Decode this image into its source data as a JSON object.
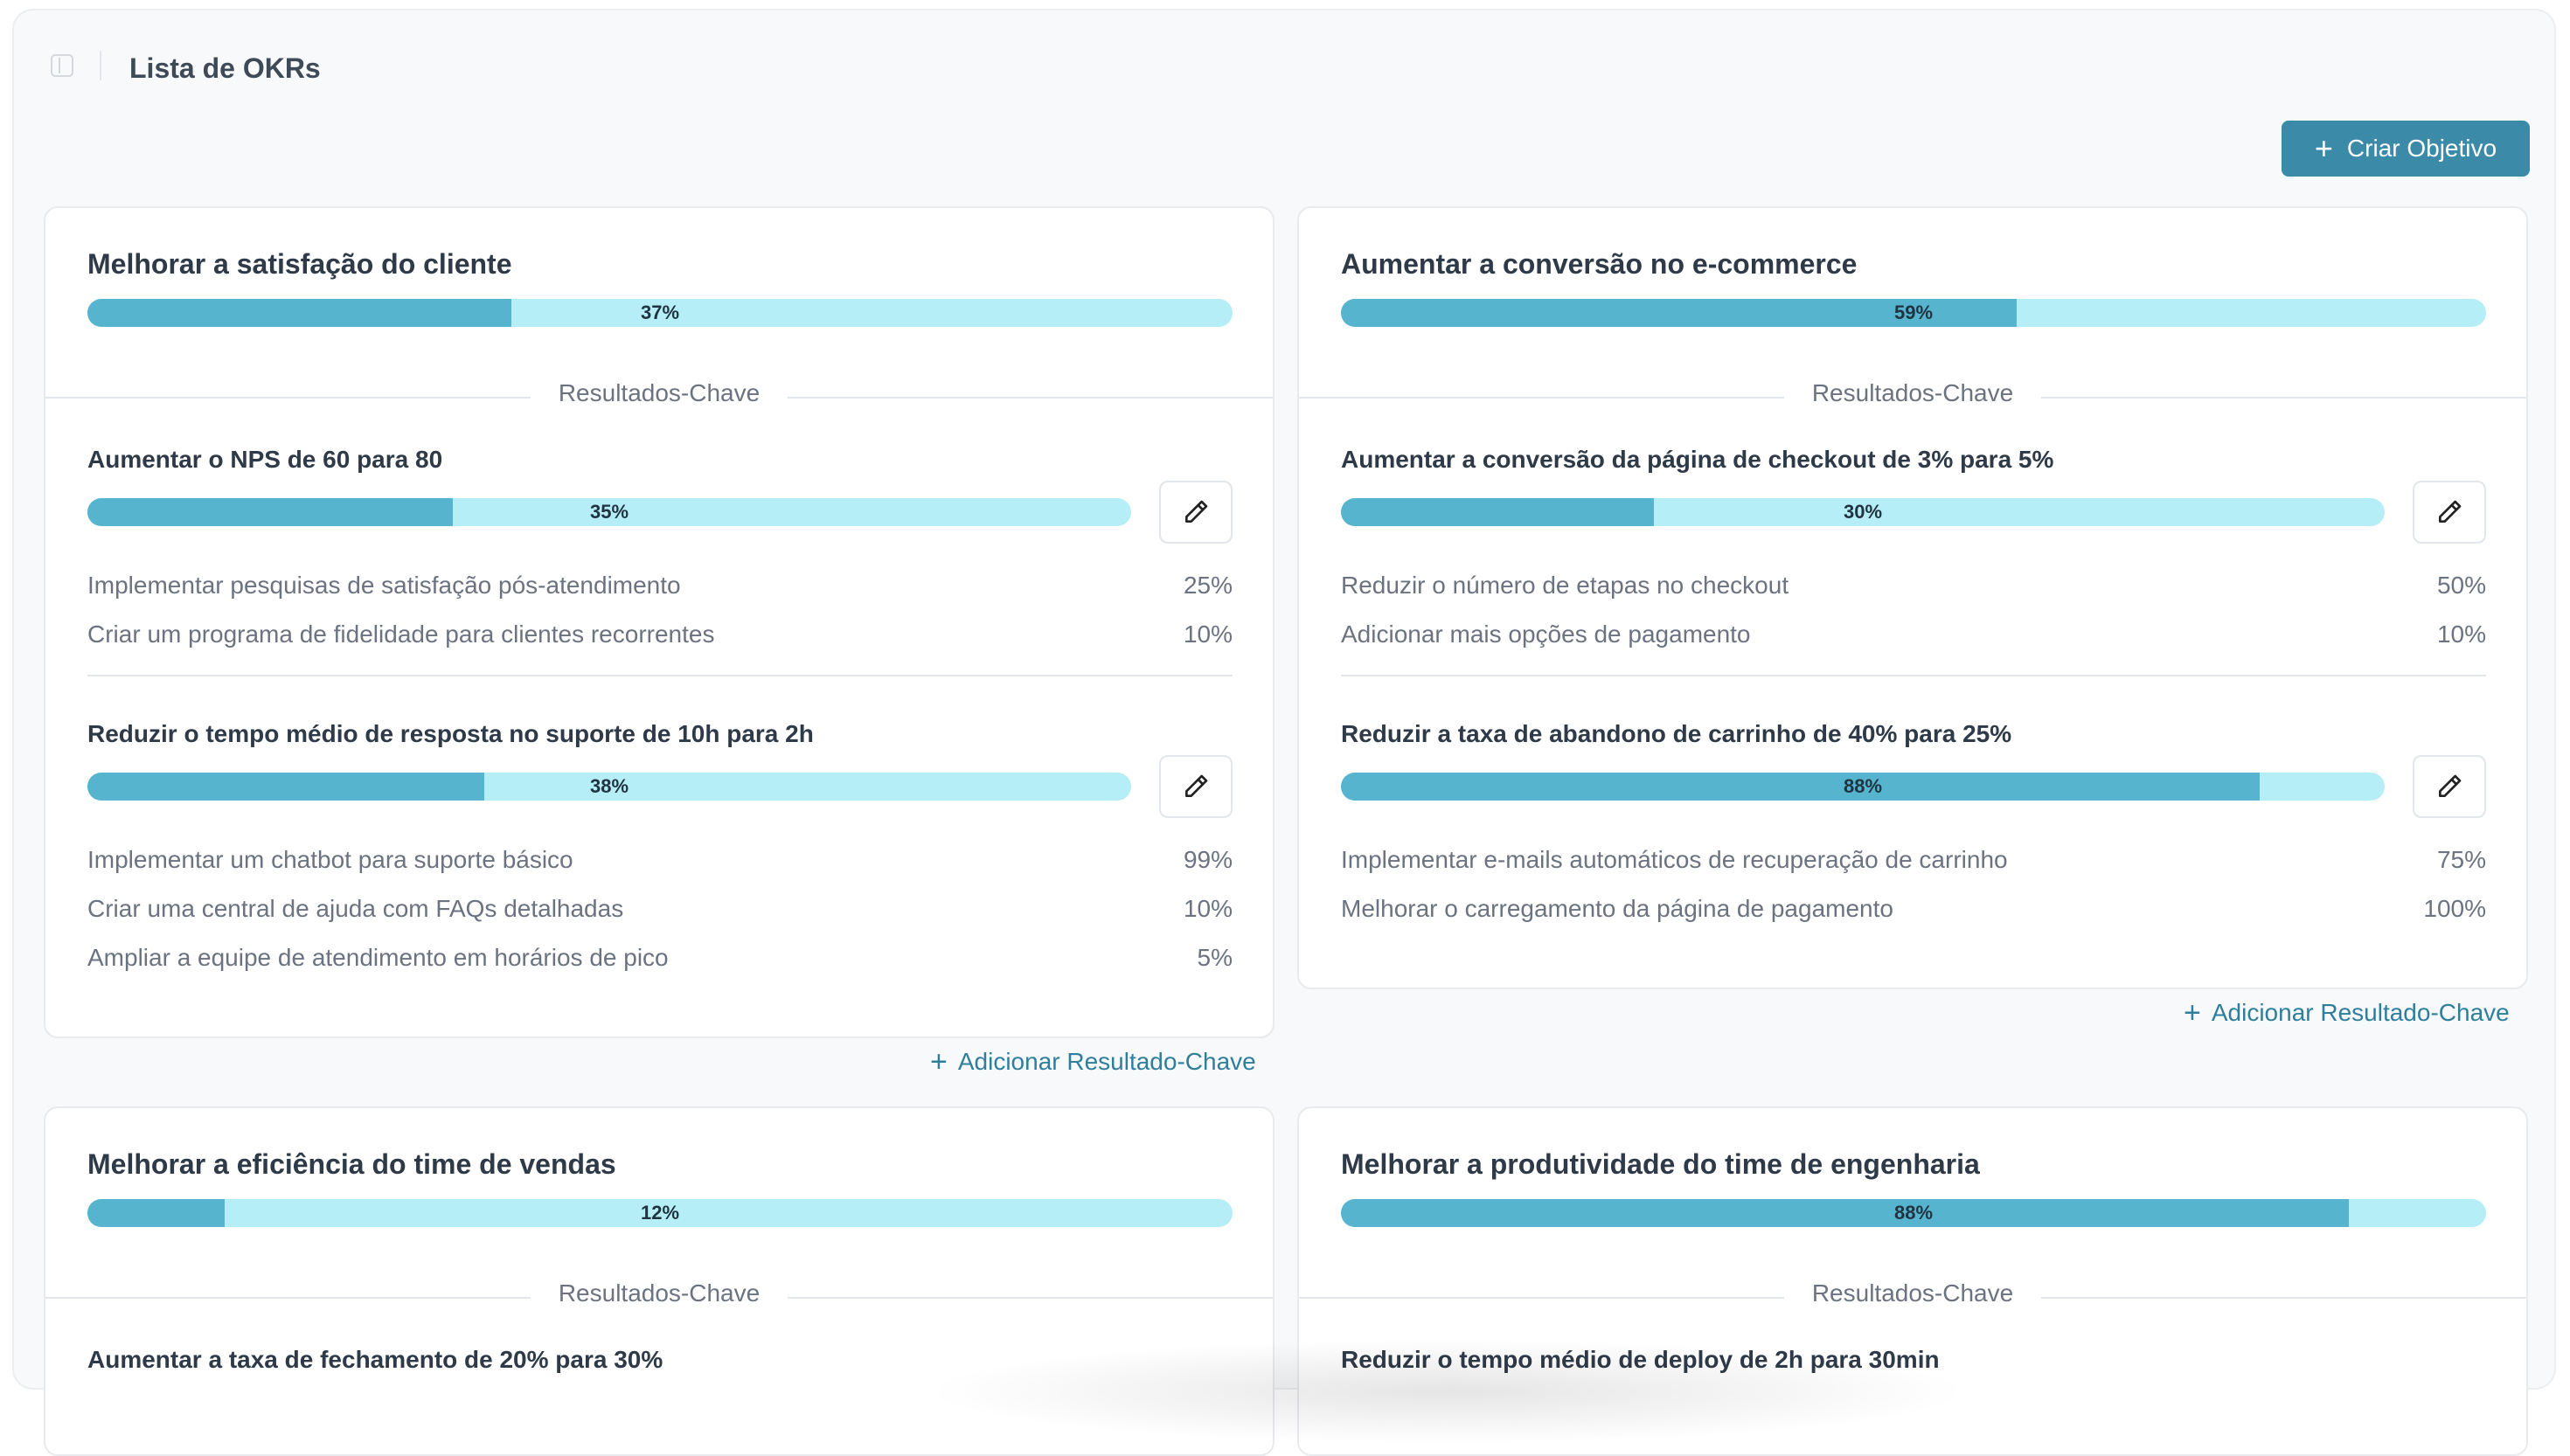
{
  "header": {
    "title": "Lista de OKRs",
    "create_button_label": "Criar Objetivo"
  },
  "colors": {
    "accent": "#3a8aa8",
    "bar_fill": "#56b4cf",
    "bar_track": "#b6eef7"
  },
  "section_label": "Resultados-Chave",
  "add_kr_label": "Adicionar Resultado-Chave",
  "objectives": [
    {
      "title": "Melhorar a satisfação do cliente",
      "progress": 37,
      "progress_label": "37%",
      "key_results": [
        {
          "title": "Aumentar o NPS de 60 para 80",
          "progress": 35,
          "progress_label": "35%",
          "tasks": [
            {
              "name": "Implementar pesquisas de satisfação pós-atendimento",
              "value": "25%"
            },
            {
              "name": "Criar um programa de fidelidade para clientes recorrentes",
              "value": "10%"
            }
          ]
        },
        {
          "title": "Reduzir o tempo médio de resposta no suporte de 10h para 2h",
          "progress": 38,
          "progress_label": "38%",
          "tasks": [
            {
              "name": "Implementar um chatbot para suporte básico",
              "value": "99%"
            },
            {
              "name": "Criar uma central de ajuda com FAQs detalhadas",
              "value": "10%"
            },
            {
              "name": "Ampliar a equipe de atendimento em horários de pico",
              "value": "5%"
            }
          ]
        }
      ]
    },
    {
      "title": "Aumentar a conversão no e-commerce",
      "progress": 59,
      "progress_label": "59%",
      "key_results": [
        {
          "title": "Aumentar a conversão da página de checkout de 3% para 5%",
          "progress": 30,
          "progress_label": "30%",
          "tasks": [
            {
              "name": "Reduzir o número de etapas no checkout",
              "value": "50%"
            },
            {
              "name": "Adicionar mais opções de pagamento",
              "value": "10%"
            }
          ]
        },
        {
          "title": "Reduzir a taxa de abandono de carrinho de 40% para 25%",
          "progress": 88,
          "progress_label": "88%",
          "tasks": [
            {
              "name": "Implementar e-mails automáticos de recuperação de carrinho",
              "value": "75%"
            },
            {
              "name": "Melhorar o carregamento da página de pagamento",
              "value": "100%"
            }
          ]
        }
      ]
    },
    {
      "title": "Melhorar a eficiência do time de vendas",
      "progress": 12,
      "progress_label": "12%",
      "key_results": [
        {
          "title": "Aumentar a taxa de fechamento de 20% para 30%"
        }
      ]
    },
    {
      "title": "Melhorar a produtividade do time de engenharia",
      "progress": 88,
      "progress_label": "88%",
      "key_results": [
        {
          "title": "Reduzir o tempo médio de deploy de 2h para 30min"
        }
      ]
    }
  ]
}
